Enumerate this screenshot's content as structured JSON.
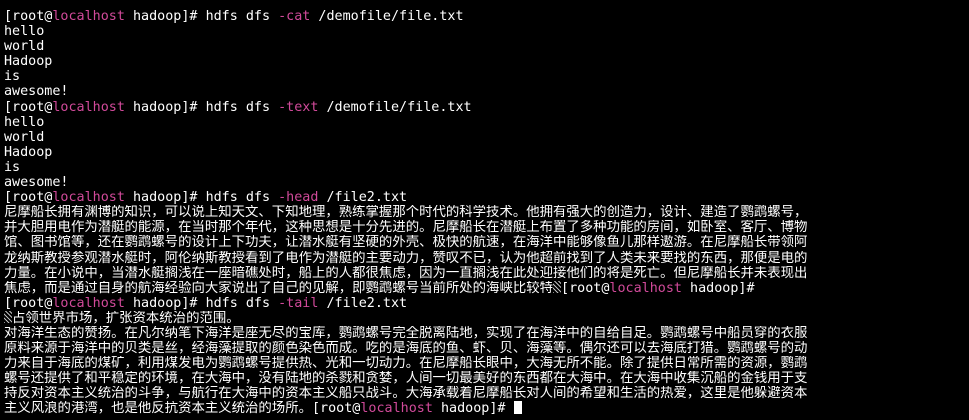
{
  "prompt": {
    "open": "[root@",
    "host": "localhost",
    "dir_part": " hadoop]# "
  },
  "commands": [
    {
      "cmd": "hdfs dfs ",
      "opt": "-cat",
      "arg": " /demofile/file.txt"
    },
    {
      "cmd": "hdfs dfs ",
      "opt": "-text",
      "arg": " /demofile/file.txt"
    },
    {
      "cmd": "hdfs dfs ",
      "opt": "-head",
      "arg": " /file2.txt"
    },
    {
      "cmd": "hdfs dfs ",
      "opt": "-tail",
      "arg": " /file2.txt"
    }
  ],
  "output_cat": [
    "hello",
    "world",
    "Hadoop",
    "is",
    "awesome!"
  ],
  "output_text": [
    "hello",
    "world",
    "Hadoop",
    "is",
    "awesome!"
  ],
  "head_lines": [
    "尼摩船长拥有渊博的知识，可以说上知天文、下知地理，熟练掌握那个时代的科学技术。他拥有强大的创造力，设计、建造了鹦鹉螺号，",
    "并大胆用电作为潜艇的能源，在当时那个年代，这种思想是十分先进的。尼摩船长在潜艇上布置了多种功能的房间，如卧室、客厅、博物",
    "馆、图书馆等，还在鹦鹉螺号的设计上下功夫，让潜水艇有坚硬的外壳、极快的航速，在海洋中能够像鱼儿那样遨游。在尼摩船长带领阿",
    "龙纳斯教授参观潜水艇时，阿伦纳斯教授看到了电作为潜艇的主要动力，赞叹不已，认为他超前找到了人类未来要找的东西，那便是电的",
    "力量。在小说中，当潜水艇搁浅在一座暗礁处时，船上的人都很焦虑，因为一直搁浅在此处迎接他们的将是死亡。但尼摩船长并未表现出",
    "焦虑，而是通过自身的航海经验向大家说出了自己的见解，即鹦鹉螺号当前所处的海峡比较特"
  ],
  "tail_first_line": "占领世界市场，扩张资本统治的范围。",
  "tail_lines": [
    "对海洋生态的赞扬。在凡尔纳笔下海洋是座无尽的宝库，鹦鹉螺号完全脱离陆地，实现了在海洋中的自给自足。鹦鹉螺号中船员穿的衣服",
    "原料来源于海洋中的贝类是丝，经海藻提取的颜色染色而成。吃的是海底的鱼、虾、贝、海藻等。偶尔还可以去海底打猎。鹦鹉螺号的动",
    "力来自于海底的煤矿，利用煤发电为鹦鹉螺号提供热、光和一切动力。在尼摩船长眼中，大海无所不能。除了提供日常所需的资源，鹦鹉",
    "螺号还提供了和平稳定的环境，在大海中，没有陆地的杀戮和贪婪，人间一切最美好的东西都在大海中。在大海中收集沉船的金钱用于支",
    "持反对资本主义统治的斗争，与航行在大海中的资本主义船只战斗。大海承载着尼摩船长对人间的希望和生活的热爱，这里是他躲避资本",
    "主义风浪的港湾，也是他反抗资本主义统治的场所。"
  ]
}
